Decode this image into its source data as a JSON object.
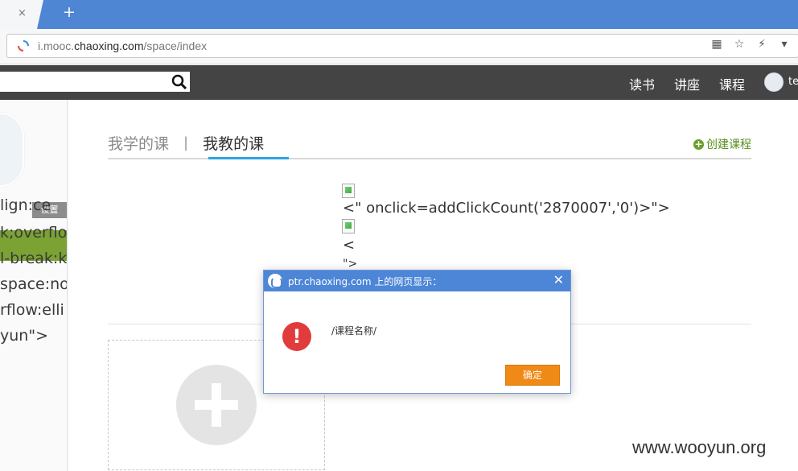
{
  "browser": {
    "new_tab_symbol": "+",
    "tab_close_symbol": "×",
    "url_prefix": "i.mooc.",
    "url_domain": "chaoxing.com",
    "url_path": "/space/index",
    "icons": [
      "qr-code-icon",
      "bookmark-star-icon",
      "lightning-icon",
      "dropdown-arrow-icon"
    ]
  },
  "header": {
    "nav": [
      "读书",
      "讲座",
      "课程"
    ],
    "user_name": "te"
  },
  "sidebar": {
    "setting_label": "设置",
    "code_lines": [
      "lign:ce",
      "k;overflo",
      "l-break:k",
      "space:no",
      "rflow:elli",
      "yun\">"
    ]
  },
  "main": {
    "tab_learn": "我学的课",
    "tab_separator": "|",
    "tab_teach": "我教的课",
    "create_course": "创建课程",
    "raw_line_1": "<\" onclick=addClickCount('2870007','0')>\">",
    "raw_line_2": "<",
    "raw_line_3": "\">"
  },
  "dialog": {
    "title": "ptr.chaoxing.com 上的网页显示：",
    "message": "/课程名称/",
    "ok_label": "确定",
    "close_symbol": "✕"
  },
  "watermark": "www.wooyun.org",
  "colors": {
    "tabbar": "#4f86d4",
    "header": "#444444",
    "accent_green": "#7ba232",
    "tab_underline": "#2aa6e0",
    "ok_button": "#f08a16",
    "alert": "#e23b3b"
  }
}
